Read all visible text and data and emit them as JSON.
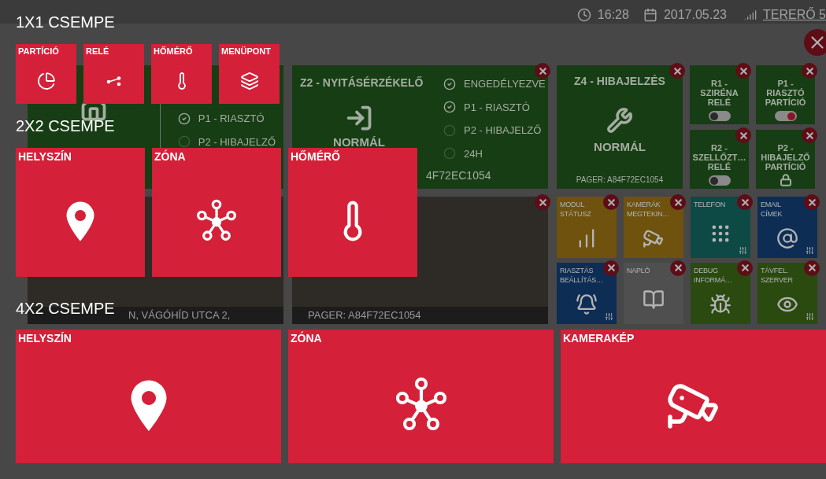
{
  "header": {
    "time": "16:28",
    "date": "2017.05.23",
    "user": "TERERŐ 5"
  },
  "zones": [
    {
      "kind": "partial",
      "flags": [
        {
          "label": "P1 - RIASZTÓ",
          "checked": true
        },
        {
          "label": "P2 - HIBAJELZŐ",
          "checked": false
        }
      ]
    },
    {
      "kind": "full",
      "title": "Z2 - NYITÁSÉRZÉKELŐ",
      "state": "NORMÁL",
      "flags": [
        {
          "label": "ENGEDÉLYEZVE",
          "checked": true
        },
        {
          "label": "P1 - RIASZTÓ",
          "checked": true
        },
        {
          "label": "P2 - HIBAJELZŐ",
          "checked": false
        },
        {
          "label": "24H",
          "checked": false
        }
      ],
      "pager": "4F72EC1054"
    }
  ],
  "fault_zone": {
    "title": "Z4 - HIBAJELZÉS",
    "state": "NORMÁL",
    "pager": "PAGER: A84F72EC1054"
  },
  "controls": [
    {
      "kind": "toggle",
      "title": "R1 - SZIRÉNA RELÉ",
      "on": false
    },
    {
      "kind": "toggle",
      "title": "P1 - RIASZTÓ PARTÍCIÓ",
      "on": true
    },
    {
      "kind": "toggle",
      "title": "R2 - SZELLŐZT… RELÉ",
      "on": false
    },
    {
      "kind": "lock",
      "title": "P2 - HIBAJELZŐ PARTÍCIÓ"
    }
  ],
  "cameras": [
    {
      "caption": "N, VÁGÓHÍD UTCA 2,"
    },
    {
      "caption": "PAGER: A84F72EC1054"
    }
  ],
  "menu_tiles": [
    {
      "title": "MODUL STÁTUSZ",
      "color": "#6e520e",
      "settings": false
    },
    {
      "title": "KAMERÁK MEGTEKIN…",
      "color": "#6e520e",
      "settings": false
    },
    {
      "title": "TELEFON",
      "color": "#0e4a45",
      "settings": true
    },
    {
      "title": "EMAIL CÍMEK",
      "color": "#0d2d55",
      "settings": true
    },
    {
      "title": "RIASZTÁS BEÁLLÍTÁS…",
      "color": "#0d2d55",
      "settings": true
    },
    {
      "title": "NAPLÓ",
      "color": "#4f4f4f",
      "settings": false
    },
    {
      "title": "DEBUG INFORMÁ…",
      "color": "#2a4a10",
      "settings": false
    },
    {
      "title": "TÁVFEL. SZERVER",
      "color": "#2a4a10",
      "settings": true
    }
  ],
  "picker": [
    {
      "kind": "small",
      "title": "1X1 CSEMPE",
      "tiles": [
        {
          "label": "PARTÍCIÓ"
        },
        {
          "label": "RELÉ"
        },
        {
          "label": "HŐMÉRŐ"
        },
        {
          "label": "MENÜPONT"
        }
      ]
    },
    {
      "kind": "medium",
      "title": "2X2 CSEMPE",
      "tiles": [
        {
          "label": "HELYSZÍN"
        },
        {
          "label": "ZÓNA"
        },
        {
          "label": "HŐMÉRŐ"
        }
      ]
    },
    {
      "kind": "large",
      "title": "4X2 CSEMPE",
      "tiles": [
        {
          "label": "HELYSZÍN"
        },
        {
          "label": "ZÓNA"
        },
        {
          "label": "KAMERAKÉP"
        }
      ]
    }
  ]
}
